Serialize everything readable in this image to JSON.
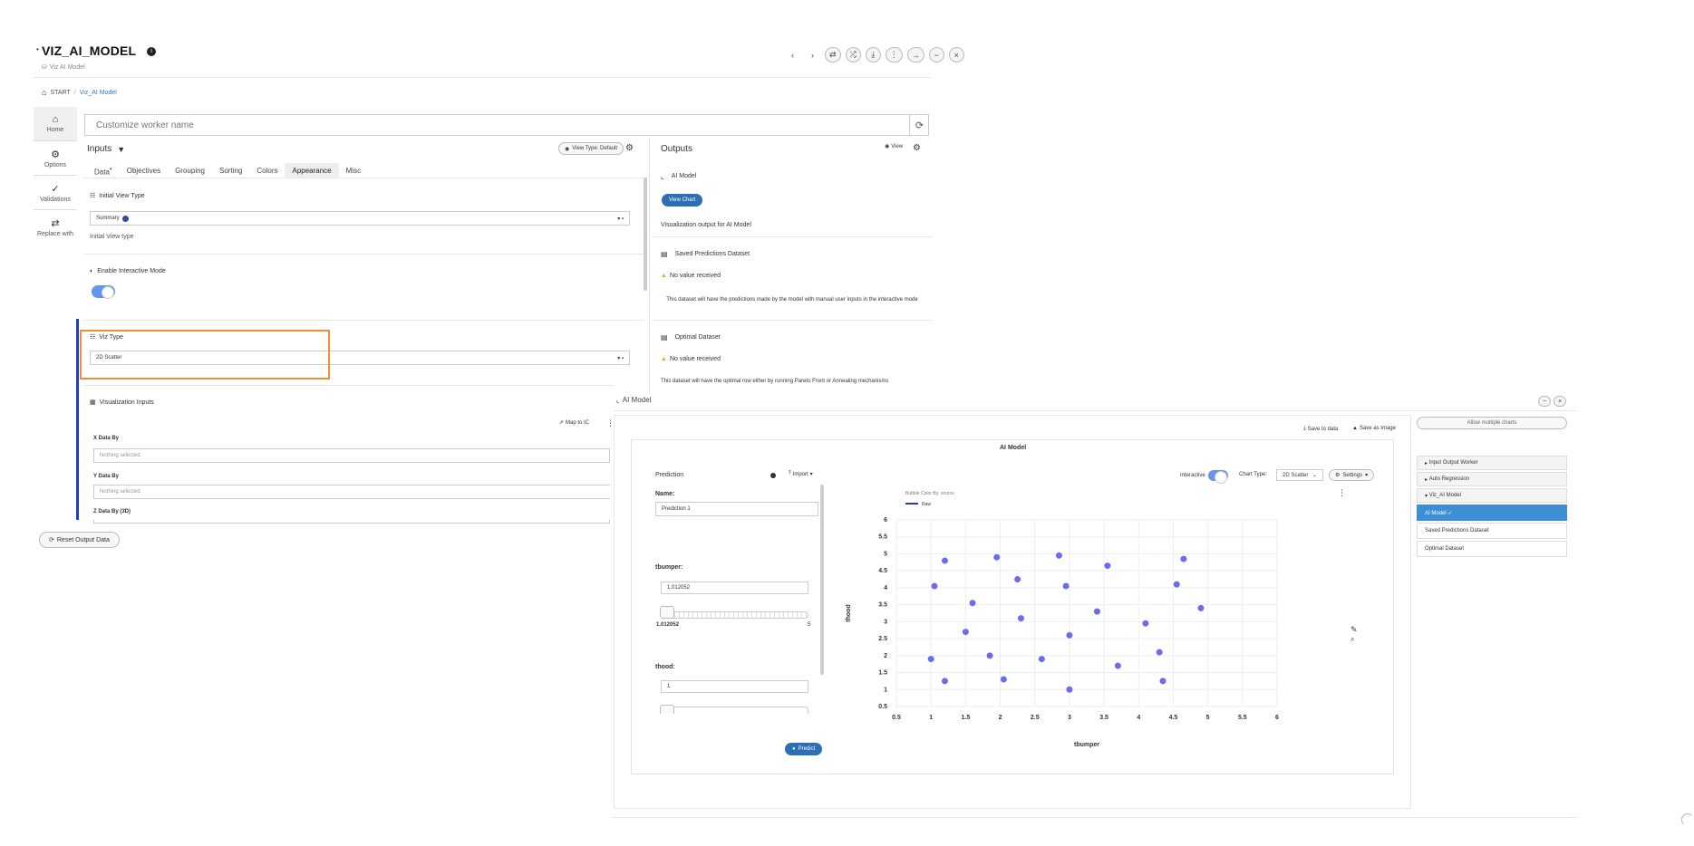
{
  "app": {
    "title": "VIZ_AI_MODEL",
    "subtitle": "Viz AI Model",
    "window_buttons": [
      "‹",
      "›",
      "⇄",
      "⤮",
      "⤓",
      "⋮",
      "→",
      "−",
      "×"
    ]
  },
  "breadcrumb": {
    "root": "START",
    "separator": "/",
    "current": "Viz_AI Model"
  },
  "sidenav": {
    "items": [
      {
        "label": "Home",
        "icon": "home-icon"
      },
      {
        "label": "Options",
        "icon": "gear-icon"
      },
      {
        "label": "Validations",
        "icon": "check-icon"
      },
      {
        "label": "Replace with",
        "icon": "swap-icon"
      }
    ]
  },
  "worker": {
    "placeholder": "Customize worker name"
  },
  "inputs": {
    "title": "Inputs",
    "view_type_button": "View Type: Default",
    "tabs": [
      "Data",
      "Objectives",
      "Grouping",
      "Sorting",
      "Colors",
      "Appearance",
      "Misc"
    ],
    "active_tab": "Appearance",
    "initial_view_type": {
      "label": "Initial View Type",
      "value": "Summary",
      "help": "Initial View type"
    },
    "interactive_mode": {
      "label": "Enable Interactive Mode",
      "enabled": true
    },
    "viz_type": {
      "label": "Viz Type",
      "value": "2D Scatter"
    },
    "viz_inputs": {
      "label": "Visualization Inputs",
      "mapping_button": "Map to IC",
      "x_label": "X Data By",
      "x_placeholder": "Nothing selected",
      "y_label": "Y Data By",
      "y_placeholder": "Nothing selected",
      "z_label": "Z Data By (3D)"
    },
    "reset_button": "Reset Output Data"
  },
  "outputs": {
    "title": "Outputs",
    "view_button": "View",
    "ai_model": {
      "label": "AI Model",
      "button": "View Chart",
      "desc": "Visualization output for AI Model"
    },
    "saved": {
      "label": "Saved Predictions Dataset",
      "warn": "No value received",
      "desc": "This dataset will have the predictions made by the model with manual user inputs in the interactive mode"
    },
    "optimal": {
      "label": "Optimal Dataset",
      "warn": "No value received",
      "desc": "This dataset will have the optimal row either by running Pareto Front or Annealing mechanisms"
    }
  },
  "chart_window": {
    "title": "AI Model",
    "save_data": "Save to data",
    "save_image": "Save as Image",
    "prediction": {
      "title": "Prediction",
      "import_button": "Import",
      "name_label": "Name:",
      "name_value": "Prediction 1",
      "tbumper_label": "tbumper:",
      "tbumper_value": "1.012052",
      "tbumper_min": "1.012052",
      "tbumper_max": "5",
      "thood_label": "thood:",
      "thood_value": "1",
      "predict_button": "Predict"
    },
    "chart_controls": {
      "interactive_label": "Interactive",
      "chart_type_label": "Chart Type:",
      "chart_type_value": "2D Scatter",
      "settings": "Settings"
    },
    "allow_multiple": "Allow multiple charts",
    "tree": [
      {
        "label": "Input Output Worker",
        "kind": "group"
      },
      {
        "label": "Auto Regression",
        "kind": "group"
      },
      {
        "label": "Viz_AI Model",
        "kind": "group"
      },
      {
        "label": "AI Model ✓",
        "kind": "selected"
      },
      {
        "label": "Saved Predictions Dataset",
        "kind": "leaf"
      },
      {
        "label": "Optimal Dataset",
        "kind": "leaf"
      }
    ]
  },
  "colors": {
    "accent": "#2c6fb4",
    "highlight_box": "#f28c38",
    "point": "#6b6bef",
    "left_bar": "#1f3fbf"
  },
  "chart_data": {
    "type": "scatter",
    "title": "AI Model",
    "xlabel": "tbumper",
    "ylabel": "thood",
    "legend_title": "Bubble Color By: source",
    "series": [
      {
        "name": "Raw",
        "points": [
          [
            1.0,
            1.9
          ],
          [
            1.05,
            4.05
          ],
          [
            1.2,
            1.25
          ],
          [
            1.2,
            4.8
          ],
          [
            1.5,
            2.7
          ],
          [
            1.6,
            3.55
          ],
          [
            1.85,
            2.0
          ],
          [
            1.95,
            4.9
          ],
          [
            2.05,
            1.3
          ],
          [
            2.25,
            4.25
          ],
          [
            2.3,
            3.1
          ],
          [
            2.6,
            1.9
          ],
          [
            2.85,
            4.95
          ],
          [
            2.95,
            4.05
          ],
          [
            3.0,
            2.6
          ],
          [
            3.0,
            1.0
          ],
          [
            3.4,
            3.3
          ],
          [
            3.55,
            4.65
          ],
          [
            3.7,
            1.7
          ],
          [
            4.1,
            2.95
          ],
          [
            4.3,
            2.1
          ],
          [
            4.35,
            1.25
          ],
          [
            4.55,
            4.1
          ],
          [
            4.65,
            4.85
          ],
          [
            4.9,
            3.4
          ]
        ]
      }
    ],
    "xlim": [
      0.5,
      6
    ],
    "ylim": [
      0.5,
      6
    ],
    "xticks": [
      "0.5",
      "1",
      "1.5",
      "2",
      "2.5",
      "3",
      "3.5",
      "4",
      "4.5",
      "5",
      "5.5",
      "6"
    ],
    "yticks": [
      "0.5",
      "1",
      "1.5",
      "2",
      "2.5",
      "3",
      "3.5",
      "4",
      "4.5",
      "5",
      "5.5",
      "6"
    ],
    "grid": true,
    "legend_position": "top-left"
  }
}
